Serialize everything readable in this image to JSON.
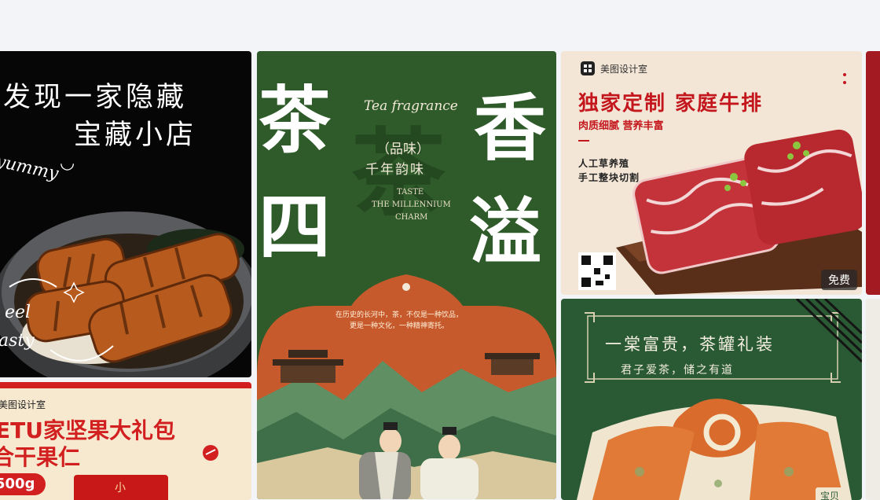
{
  "cards": {
    "eel": {
      "title_line1": "发现一家隐藏",
      "title_line2": "宝藏小店",
      "script_top": "yummy",
      "script_face": "◡",
      "script_bottom1": "eel",
      "script_bottom2": "asty"
    },
    "nut": {
      "brand": "美图设计室",
      "title_line1": "ETU家坚果大礼包",
      "title_line2": "合干果仁",
      "weight": "500g",
      "box_label": "小"
    },
    "tea": {
      "script": "Tea fragrance",
      "char_left_top": "茶",
      "char_left_bottom": "四",
      "char_right_top": "香",
      "char_right_bottom": "溢",
      "ghost_char": "茶",
      "subtitle1": "（品味）",
      "subtitle2": "千年韵味",
      "en_line1": "TASTE",
      "en_line2": "THE MILLENNIUM",
      "en_line3": "CHARM",
      "body_line1": "在历史的长河中，茶，不仅是一种饮品，",
      "body_line2": "更是一种文化，一种精神寄托。"
    },
    "steak": {
      "brand": "美图设计室",
      "title": "独家定制 家庭牛排",
      "subtitle": "肉质细腻 营养丰富",
      "note1": "人工草养殖",
      "note2": "手工整块切割",
      "badge": "免费"
    },
    "gift": {
      "title": "一棠富贵，茶罐礼装",
      "subtitle": "君子爱茶，储之有道",
      "corner": "宝贝"
    }
  },
  "colors": {
    "page_bg": "#f3f4f8",
    "tea_green": "#2f5b2a",
    "tea_orange": "#c75a2c",
    "steak_red": "#c4171d",
    "nut_red": "#d21f1f",
    "gift_green": "#2a5a34"
  }
}
